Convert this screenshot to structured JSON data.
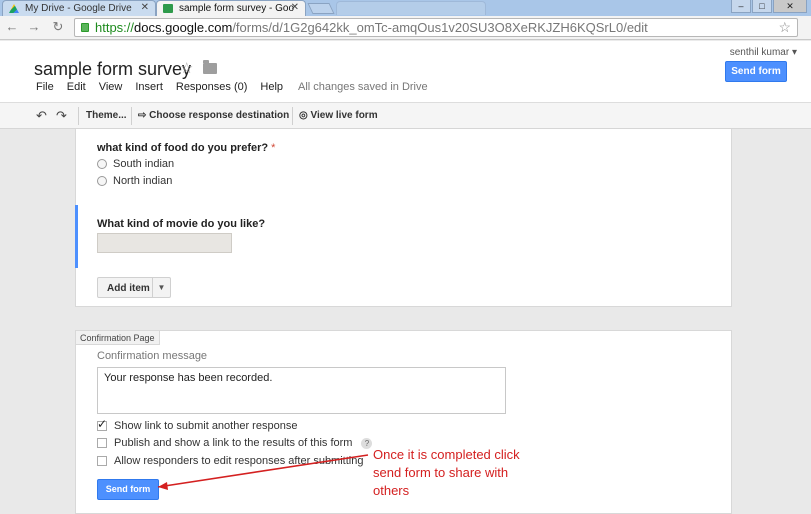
{
  "browser": {
    "tabs": [
      {
        "title": "My Drive - Google Drive",
        "icon": "google-drive-icon"
      },
      {
        "title": "sample form survey - Goo",
        "icon": "google-forms-icon"
      }
    ],
    "url": {
      "scheme": "https://",
      "host": "docs.google.com",
      "path": "/forms/d/1G2g642kk_omTc-amqOus1v20SU3O8XeRKJZH6KQSrL0/edit"
    }
  },
  "header": {
    "doc_title": "sample form survey",
    "user_name": "senthil kumar ▾",
    "send_form_label": "Send form",
    "menu": [
      "File",
      "Edit",
      "View",
      "Insert",
      "Responses (0)",
      "Help"
    ],
    "save_status": "All changes saved in Drive"
  },
  "toolbar": {
    "theme_label": "Theme...",
    "response_dest_label": "Choose response destination",
    "live_form_label": "View live form"
  },
  "questions": [
    {
      "title": "what kind of food do you prefer?",
      "required_mark": "*",
      "options": [
        "South indian",
        "North indian"
      ]
    },
    {
      "title": "What kind of movie do you like?",
      "answer_placeholder": ""
    }
  ],
  "add_item_label": "Add item",
  "confirmation": {
    "tab_label": "Confirmation Page",
    "message_label": "Confirmation message",
    "message_text": "Your response has been recorded.",
    "options": [
      {
        "label": "Show link to submit another response",
        "checked": true
      },
      {
        "label": "Publish and show a link to the results of this form",
        "checked": false,
        "help": "?"
      },
      {
        "label": "Allow responders to edit responses after submitting",
        "checked": false
      }
    ],
    "send_form_label": "Send form"
  },
  "annotation": {
    "text": "Once it is completed click send form to share with others",
    "color": "#d42020"
  },
  "colors": {
    "accent": "#4d90fe"
  }
}
